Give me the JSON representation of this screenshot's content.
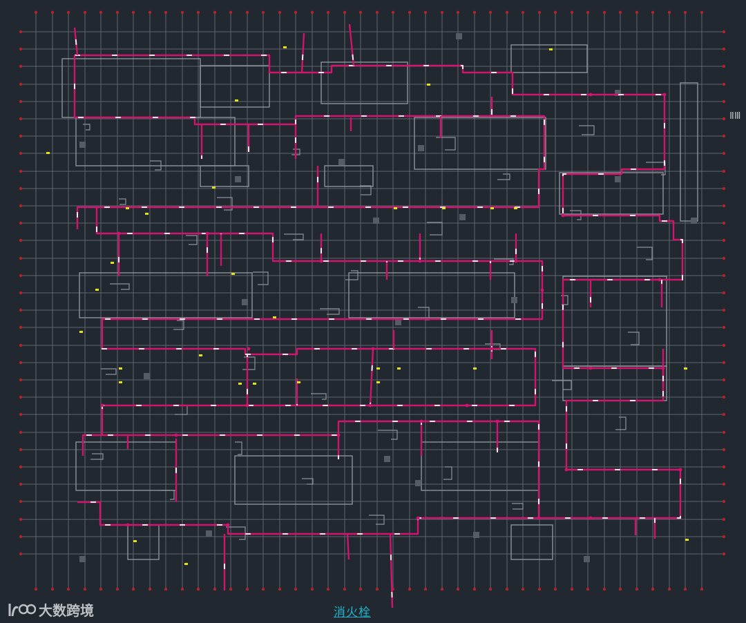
{
  "drawing": {
    "caption": "消火栓",
    "watermark_text": "大数跨境",
    "watermark_logo_text": "1∞",
    "edge_marks": "ⅡⅢ"
  },
  "colors": {
    "background": "#212830",
    "grid": "#5e6670",
    "walls": "#8d939a",
    "pipe": "#d3146e",
    "pipe_dash": "#ffffff",
    "axis_bubble": "#b3232a",
    "hydrant_marker": "#e6e21a",
    "caption": "#1fb3c9"
  }
}
